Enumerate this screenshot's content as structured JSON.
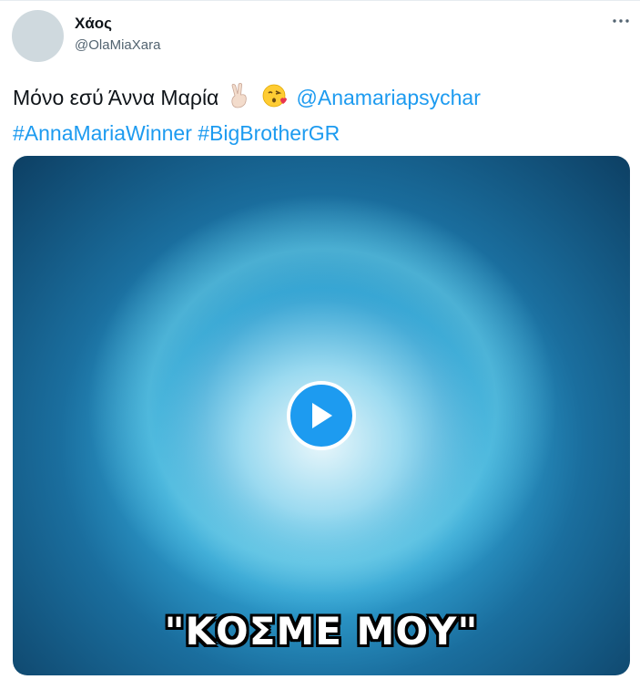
{
  "tweet": {
    "display_name": "Χάος",
    "handle": "@OlaMiaXara",
    "text_plain": "Μόνο εσύ Άννα Μαρία",
    "emojis": [
      "victory-hand-emoji",
      "face-blowing-kiss-emoji"
    ],
    "mention": "@Anamariapsychar",
    "hashtags": [
      "#AnnaMariaWinner",
      "#BigBrotherGR"
    ]
  },
  "media": {
    "caption": "\"ΚΟΣΜΕ ΜΟΥ\"",
    "play_icon": "play-icon"
  },
  "colors": {
    "link": "#1d9bf0",
    "text": "#0f1419",
    "secondary": "#536471",
    "play_button": "#1d9bf0"
  }
}
